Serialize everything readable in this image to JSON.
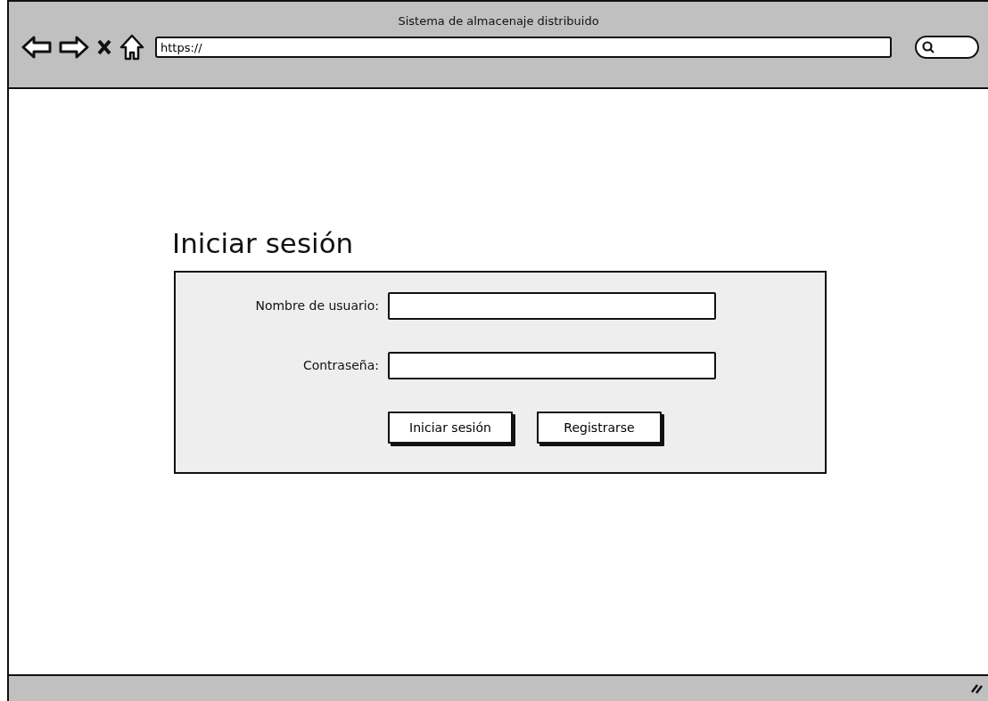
{
  "window": {
    "title": "Sistema de almacenaje distribuido"
  },
  "address_bar": {
    "value": "https://"
  },
  "heading": "Iniciar sesión",
  "fields": [
    {
      "label": "Nombre de usuario:"
    },
    {
      "label": "Contraseña:"
    }
  ],
  "buttons": [
    "Iniciar sesión",
    "Registrarse"
  ]
}
